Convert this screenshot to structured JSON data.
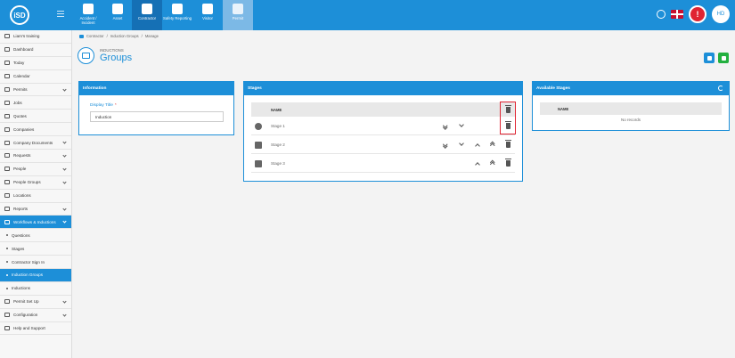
{
  "topbar": {
    "logo_text": "iSD",
    "modules": [
      {
        "label": "Accident / Incident",
        "active": false,
        "faded": false
      },
      {
        "label": "Asset",
        "active": false,
        "faded": false
      },
      {
        "label": "Contractor",
        "active": true,
        "faded": false
      },
      {
        "label": "Safety Reporting",
        "active": false,
        "faded": false
      },
      {
        "label": "Visitor",
        "active": false,
        "faded": false
      },
      {
        "label": "Permit",
        "active": false,
        "faded": true
      }
    ],
    "avatar_initials": "HD"
  },
  "sidebar": {
    "items": [
      {
        "label": "Liam's training",
        "icon": "branch-icon",
        "sub": false,
        "active": false,
        "chevron": false
      },
      {
        "label": "Dashboard",
        "icon": "dashboard-icon",
        "sub": false,
        "active": false,
        "chevron": false
      },
      {
        "label": "Today",
        "icon": "calendar-today-icon",
        "sub": false,
        "active": false,
        "chevron": false
      },
      {
        "label": "Calendar",
        "icon": "calendar-icon",
        "sub": false,
        "active": false,
        "chevron": false
      },
      {
        "label": "Permits",
        "icon": "permit-icon",
        "sub": false,
        "active": false,
        "chevron": true
      },
      {
        "label": "Jobs",
        "icon": "jobs-icon",
        "sub": false,
        "active": false,
        "chevron": false
      },
      {
        "label": "Quotes",
        "icon": "quotes-icon",
        "sub": false,
        "active": false,
        "chevron": false
      },
      {
        "label": "Companies",
        "icon": "companies-icon",
        "sub": false,
        "active": false,
        "chevron": false
      },
      {
        "label": "Company Documents",
        "icon": "documents-icon",
        "sub": false,
        "active": false,
        "chevron": true
      },
      {
        "label": "Requests",
        "icon": "requests-icon",
        "sub": false,
        "active": false,
        "chevron": true
      },
      {
        "label": "People",
        "icon": "people-icon",
        "sub": false,
        "active": false,
        "chevron": true
      },
      {
        "label": "People Groups",
        "icon": "people-groups-icon",
        "sub": false,
        "active": false,
        "chevron": true
      },
      {
        "label": "Locations",
        "icon": "locations-icon",
        "sub": false,
        "active": false,
        "chevron": false
      },
      {
        "label": "Reports",
        "icon": "reports-icon",
        "sub": false,
        "active": false,
        "chevron": true
      },
      {
        "label": "Workflows & Inductions",
        "icon": "workflow-icon",
        "sub": false,
        "active": true,
        "chevron": true
      },
      {
        "label": "Questions",
        "icon": "",
        "sub": true,
        "active": false,
        "chevron": false
      },
      {
        "label": "Stages",
        "icon": "",
        "sub": true,
        "active": false,
        "chevron": false
      },
      {
        "label": "Contractor Sign In",
        "icon": "",
        "sub": true,
        "active": false,
        "chevron": false
      },
      {
        "label": "Induction Groups",
        "icon": "",
        "sub": true,
        "active": true,
        "chevron": false
      },
      {
        "label": "Inductions",
        "icon": "",
        "sub": true,
        "active": false,
        "chevron": false
      },
      {
        "label": "Permit Set Up",
        "icon": "permit-setup-icon",
        "sub": false,
        "active": false,
        "chevron": true
      },
      {
        "label": "Configuration",
        "icon": "configuration-icon",
        "sub": false,
        "active": false,
        "chevron": true
      },
      {
        "label": "Help and Support",
        "icon": "help-icon",
        "sub": false,
        "active": false,
        "chevron": false
      }
    ]
  },
  "breadcrumb": {
    "items": [
      "Contractor",
      "Induction Groups",
      "Manage"
    ]
  },
  "page": {
    "subtitle": "INDUCTIONS",
    "title": "Groups"
  },
  "information": {
    "heading": "Information",
    "display_title_label": "Display Title",
    "display_title_value": "Induction"
  },
  "stages": {
    "heading": "Stages",
    "name_column": "NAME",
    "rows": [
      {
        "name": "Stage 1",
        "icon": "check-circle-icon"
      },
      {
        "name": "Stage 2",
        "icon": "building-icon"
      },
      {
        "name": "Stage 3",
        "icon": "building-icon"
      }
    ]
  },
  "available_stages": {
    "heading": "Available Stages",
    "name_column": "NAME",
    "empty_text": "No records"
  },
  "colors": {
    "primary": "#1d8fd8",
    "save": "#23b03f",
    "alert": "#e02432"
  }
}
